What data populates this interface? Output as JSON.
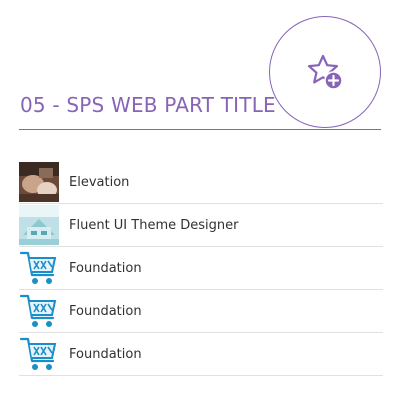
{
  "webpart": {
    "title": "05 - SPS WEB PART TITLE",
    "accent_color": "#8764b8",
    "favorite_button_icon": "favorite-star-add-icon"
  },
  "items": [
    {
      "label": "Elevation",
      "icon": "elevation-photo-thumbnail"
    },
    {
      "label": "Fluent UI Theme Designer",
      "icon": "fluent-ui-photo-thumbnail"
    },
    {
      "label": "Foundation",
      "icon": "shopping-cart-icon"
    },
    {
      "label": "Foundation",
      "icon": "shopping-cart-icon"
    },
    {
      "label": "Foundation",
      "icon": "shopping-cart-icon"
    }
  ]
}
